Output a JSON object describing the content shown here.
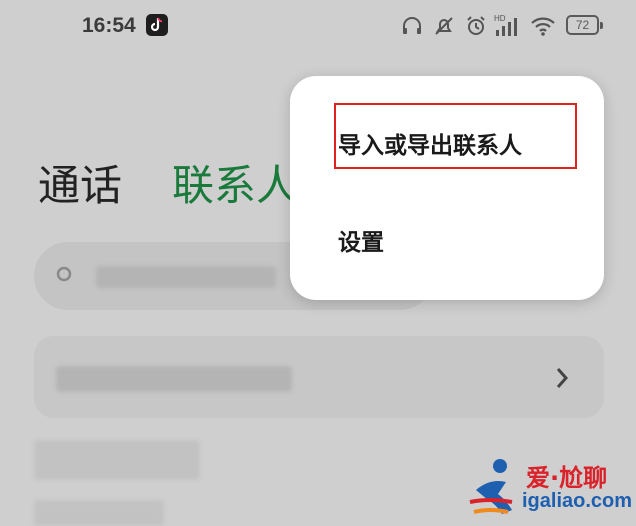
{
  "status_bar": {
    "time": "16:54",
    "battery": "72",
    "icons": [
      "headphones-icon",
      "mute-bell-icon",
      "alarm-icon",
      "hd-signal-icon",
      "wifi-icon",
      "battery-icon"
    ]
  },
  "tabs": {
    "calls": "通话",
    "contacts": "联系人"
  },
  "menu": {
    "items": [
      {
        "label": "导入或导出联系人",
        "highlighted": true
      },
      {
        "label": "设置",
        "highlighted": false
      }
    ]
  },
  "colors": {
    "contacts_tab": "#1a7a3b",
    "highlight_border": "#e0211f",
    "watermark_red": "#d9222a",
    "watermark_blue": "#1f5fb0"
  },
  "watermark": {
    "title": "爱·尬聊",
    "domain": "igaliao.com"
  }
}
